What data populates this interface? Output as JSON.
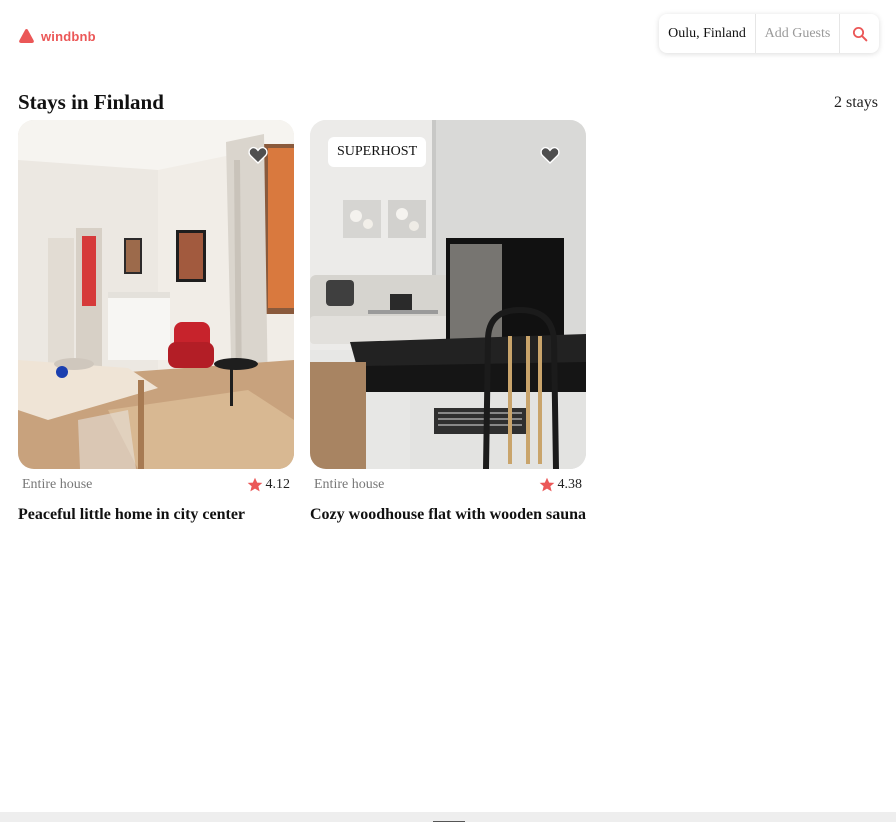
{
  "brand": {
    "name": "windbnb",
    "color": "#eb5757"
  },
  "search": {
    "location": "Oulu, Finland",
    "guests_placeholder": "Add Guests",
    "button_icon": "search-icon"
  },
  "heading": {
    "title": "Stays in Finland",
    "count": "2 stays"
  },
  "stays": [
    {
      "type": "Entire house",
      "rating": "4.12",
      "title": "Peaceful little home in city center",
      "superhost": false,
      "favorite_icon": "heart-icon"
    },
    {
      "type": "Entire house",
      "rating": "4.38",
      "title": "Cozy woodhouse flat with wooden sauna",
      "superhost": true,
      "superhost_label": "SUPERHOST",
      "favorite_icon": "heart-icon"
    }
  ],
  "colors": {
    "accent": "#eb5757",
    "star": "#eb5757",
    "muted_text": "#777777"
  }
}
